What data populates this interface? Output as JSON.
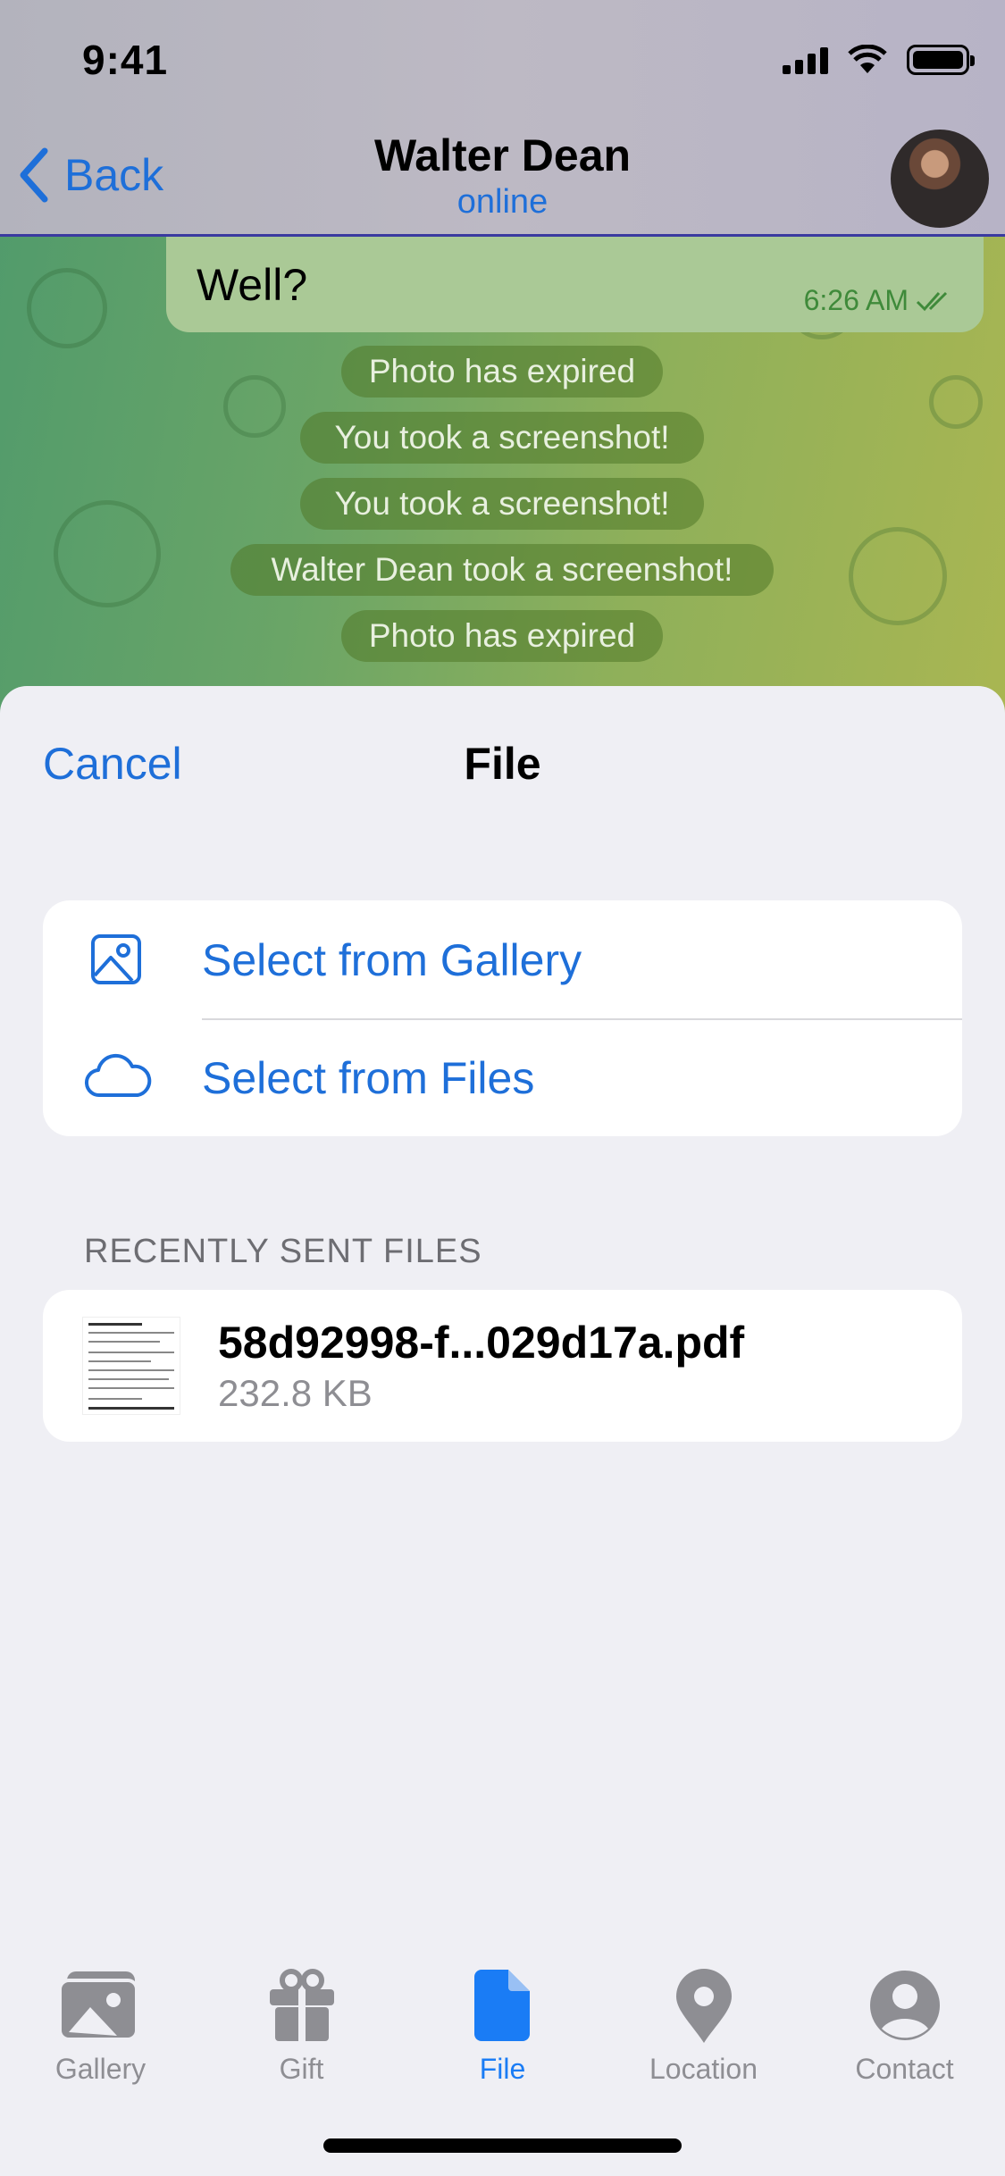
{
  "status_bar": {
    "time": "9:41"
  },
  "nav": {
    "back_label": "Back",
    "title": "Walter Dean",
    "subtitle": "online"
  },
  "message": {
    "text": "Well?",
    "time": "6:26 AM"
  },
  "service_messages": [
    "Photo has expired",
    "You took a screenshot!",
    "You took a screenshot!",
    "Walter Dean took a screenshot!",
    "Photo has expired"
  ],
  "sheet": {
    "cancel_label": "Cancel",
    "title": "File",
    "options": [
      {
        "label": "Select from Gallery",
        "icon": "gallery-icon"
      },
      {
        "label": "Select from Files",
        "icon": "cloud-icon"
      }
    ],
    "recent_header": "RECENTLY SENT FILES",
    "recent_files": [
      {
        "name": "58d92998-f...029d17a.pdf",
        "size": "232.8 KB"
      }
    ]
  },
  "tabbar": {
    "tabs": [
      {
        "label": "Gallery",
        "icon": "gallery-icon",
        "active": false
      },
      {
        "label": "Gift",
        "icon": "gift-icon",
        "active": false
      },
      {
        "label": "File",
        "icon": "file-icon",
        "active": true
      },
      {
        "label": "Location",
        "icon": "location-icon",
        "active": false
      },
      {
        "label": "Contact",
        "icon": "contact-icon",
        "active": false
      }
    ]
  },
  "colors": {
    "accent": "#1e6fd9",
    "active_tab": "#1a7cf5",
    "bubble": "#aac996"
  }
}
